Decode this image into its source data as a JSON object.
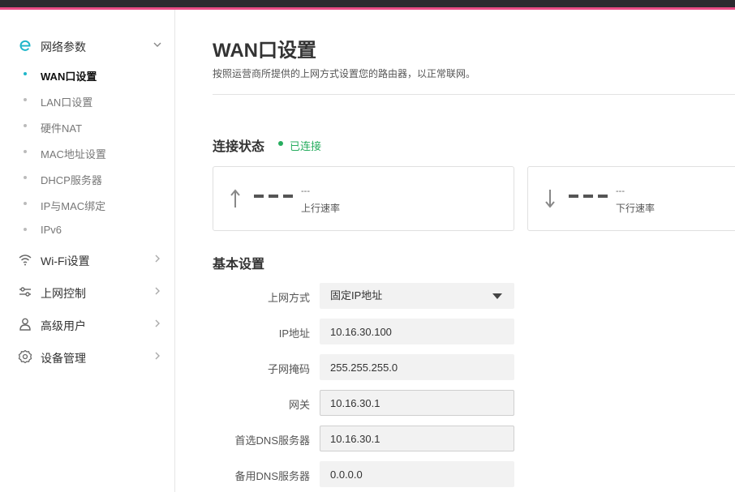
{
  "sidebar": {
    "groups": [
      {
        "label": "网络参数",
        "icon": "network-e-icon",
        "expanded": true
      },
      {
        "label": "Wi-Fi设置",
        "icon": "wifi-icon",
        "expanded": false
      },
      {
        "label": "上网控制",
        "icon": "sliders-icon",
        "expanded": false
      },
      {
        "label": "高级用户",
        "icon": "user-icon",
        "expanded": false
      },
      {
        "label": "设备管理",
        "icon": "gear-icon",
        "expanded": false
      }
    ],
    "network_items": [
      {
        "label": "WAN口设置",
        "active": true
      },
      {
        "label": "LAN口设置",
        "active": false
      },
      {
        "label": "硬件NAT",
        "active": false
      },
      {
        "label": "MAC地址设置",
        "active": false
      },
      {
        "label": "DHCP服务器",
        "active": false
      },
      {
        "label": "IP与MAC绑定",
        "active": false
      },
      {
        "label": "IPv6",
        "active": false
      }
    ]
  },
  "main": {
    "title": "WAN口设置",
    "description": "按照运营商所提供的上网方式设置您的路由器，以正常联网。",
    "connection": {
      "section_title": "连接状态",
      "status": "已连接",
      "upload": {
        "value": "---",
        "label": "上行速率",
        "icon": "arrow-up-icon"
      },
      "download": {
        "value": "---",
        "label": "下行速率",
        "icon": "arrow-down-icon"
      }
    },
    "basic": {
      "section_title": "基本设置",
      "fields": [
        {
          "label": "上网方式",
          "value": "固定IP地址",
          "type": "select"
        },
        {
          "label": "IP地址",
          "value": "10.16.30.100",
          "type": "text"
        },
        {
          "label": "子网掩码",
          "value": "255.255.255.0",
          "type": "text"
        },
        {
          "label": "网关",
          "value": "10.16.30.1",
          "type": "text"
        },
        {
          "label": "首选DNS服务器",
          "value": "10.16.30.1",
          "type": "text"
        },
        {
          "label": "备用DNS服务器",
          "value": "0.0.0.0",
          "type": "text"
        }
      ]
    }
  },
  "colors": {
    "accent_pink": "#e84c86",
    "topbar": "#2b2b30",
    "active_dot": "#1fb6c9",
    "status_green": "#27ad5f"
  }
}
